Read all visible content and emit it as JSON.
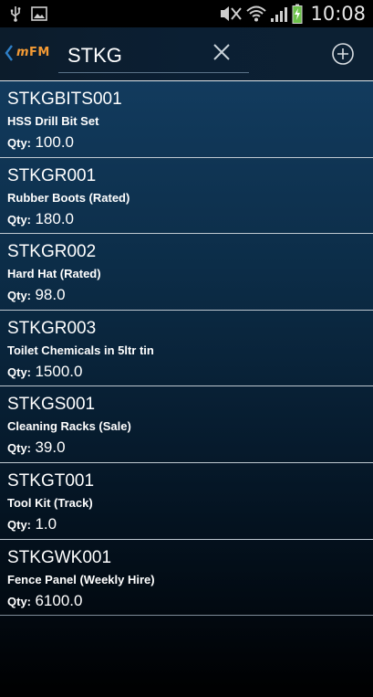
{
  "status_bar": {
    "time": "10:08",
    "icons": [
      "usb-icon",
      "image-icon",
      "mute-icon",
      "wifi-icon",
      "signal-icon",
      "battery-charging-icon"
    ]
  },
  "action_bar": {
    "logo_m": "m",
    "logo_fm": "FM",
    "search_value": "STKG",
    "clear_icon": "close-icon",
    "add_icon": "add-circle-icon",
    "accent_color": "#f49a34"
  },
  "items": [
    {
      "code": "STKGBITS001",
      "description": "HSS Drill Bit Set",
      "qty_label": "Qty:",
      "qty": "100.0"
    },
    {
      "code": "STKGR001",
      "description": "Rubber Boots (Rated)",
      "qty_label": "Qty:",
      "qty": "180.0"
    },
    {
      "code": "STKGR002",
      "description": "Hard Hat (Rated)",
      "qty_label": "Qty:",
      "qty": "98.0"
    },
    {
      "code": "STKGR003",
      "description": "Toilet Chemicals in 5ltr tin",
      "qty_label": "Qty:",
      "qty": "1500.0"
    },
    {
      "code": "STKGS001",
      "description": "Cleaning Racks (Sale)",
      "qty_label": "Qty:",
      "qty": "39.0"
    },
    {
      "code": "STKGT001",
      "description": "Tool Kit (Track)",
      "qty_label": "Qty:",
      "qty": "1.0"
    },
    {
      "code": "STKGWK001",
      "description": "Fence Panel (Weekly Hire)",
      "qty_label": "Qty:",
      "qty": "6100.0"
    }
  ]
}
